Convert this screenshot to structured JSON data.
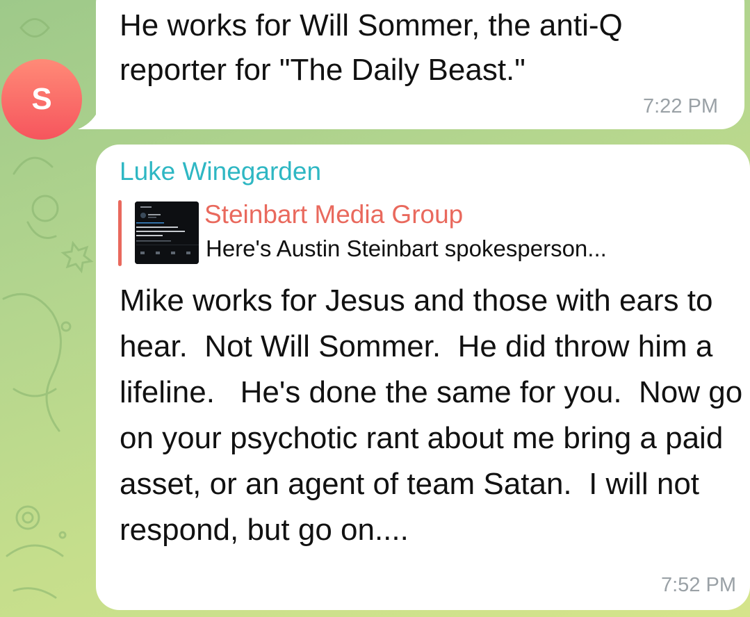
{
  "messages": [
    {
      "avatar_initial": "S",
      "text": "He works for Will Sommer, the anti-Q reporter for \"The Daily Beast.\"",
      "time": "7:22 PM"
    },
    {
      "sender": "Luke Winegarden",
      "reply": {
        "title": "Steinbart Media Group",
        "text": "Here's Austin Steinbart spokesperson..."
      },
      "text": "Mike works for Jesus and those with ears to hear.  Not Will Sommer.  He did throw him a lifeline.   He's done the same for you.  Now go on your psychotic rant about me bring a paid asset, or an agent of team Satan.  I will not respond, but go on....",
      "time": "7:52 PM"
    }
  ],
  "colors": {
    "sender_name": "#2eb7c3",
    "reply_accent": "#e9695d",
    "avatar": "#f6555d"
  }
}
